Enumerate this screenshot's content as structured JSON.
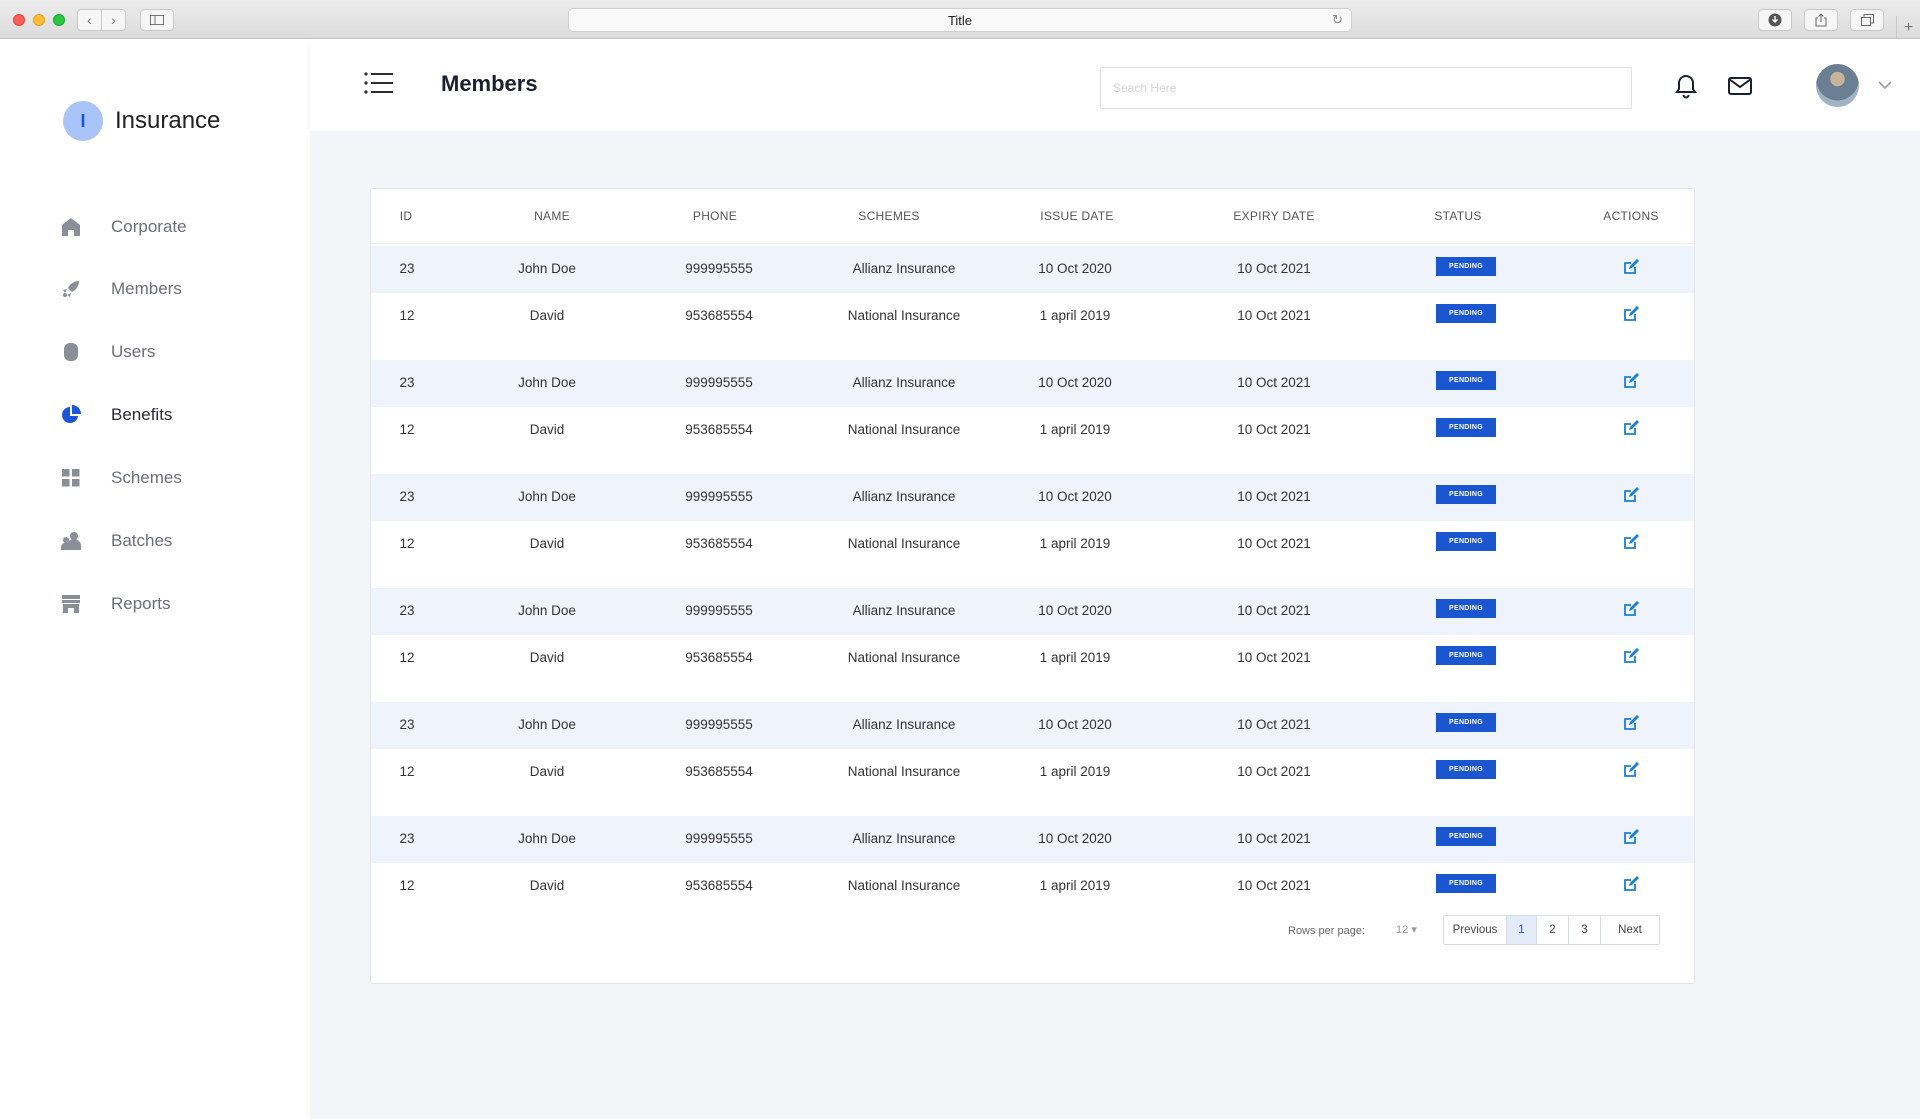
{
  "browser": {
    "title": "Title"
  },
  "sidebar": {
    "logo_letter": "I",
    "logo_text": "Insurance",
    "items": [
      {
        "label": "Corporate",
        "icon": "home-icon"
      },
      {
        "label": "Members",
        "icon": "rocket-icon"
      },
      {
        "label": "Users",
        "icon": "user-icon"
      },
      {
        "label": "Benefits",
        "icon": "pie-chart-icon",
        "active": true
      },
      {
        "label": "Schemes",
        "icon": "grid-icon"
      },
      {
        "label": "Batches",
        "icon": "users-icon"
      },
      {
        "label": "Reports",
        "icon": "store-icon"
      }
    ]
  },
  "header": {
    "title": "Members",
    "search_placeholder": "Seach Here"
  },
  "table": {
    "columns": [
      "ID",
      "NAME",
      "PHONE",
      "SCHEMES",
      "ISSUE DATE",
      "EXPIRY DATE",
      "STATUS",
      "ACTIONS"
    ],
    "rows": [
      {
        "id": "23",
        "name": "John Doe",
        "phone": "999995555",
        "scheme": "Allianz Insurance",
        "issue": "10 Oct 2020",
        "expiry": "10 Oct 2021",
        "status": "PENDING"
      },
      {
        "id": "12",
        "name": "David",
        "phone": "953685554",
        "scheme": "National Insurance",
        "issue": "1 april 2019",
        "expiry": "10 Oct 2021",
        "status": "PENDING"
      },
      {
        "id": "23",
        "name": "John Doe",
        "phone": "999995555",
        "scheme": "Allianz Insurance",
        "issue": "10 Oct 2020",
        "expiry": "10 Oct 2021",
        "status": "PENDING"
      },
      {
        "id": "12",
        "name": "David",
        "phone": "953685554",
        "scheme": "National Insurance",
        "issue": "1 april 2019",
        "expiry": "10 Oct 2021",
        "status": "PENDING"
      },
      {
        "id": "23",
        "name": "John Doe",
        "phone": "999995555",
        "scheme": "Allianz Insurance",
        "issue": "10 Oct 2020",
        "expiry": "10 Oct 2021",
        "status": "PENDING"
      },
      {
        "id": "12",
        "name": "David",
        "phone": "953685554",
        "scheme": "National Insurance",
        "issue": "1 april 2019",
        "expiry": "10 Oct 2021",
        "status": "PENDING"
      },
      {
        "id": "23",
        "name": "John Doe",
        "phone": "999995555",
        "scheme": "Allianz Insurance",
        "issue": "10 Oct 2020",
        "expiry": "10 Oct 2021",
        "status": "PENDING"
      },
      {
        "id": "12",
        "name": "David",
        "phone": "953685554",
        "scheme": "National Insurance",
        "issue": "1 april 2019",
        "expiry": "10 Oct 2021",
        "status": "PENDING"
      },
      {
        "id": "23",
        "name": "John Doe",
        "phone": "999995555",
        "scheme": "Allianz Insurance",
        "issue": "10 Oct 2020",
        "expiry": "10 Oct 2021",
        "status": "PENDING"
      },
      {
        "id": "12",
        "name": "David",
        "phone": "953685554",
        "scheme": "National Insurance",
        "issue": "1 april 2019",
        "expiry": "10 Oct 2021",
        "status": "PENDING"
      },
      {
        "id": "23",
        "name": "John Doe",
        "phone": "999995555",
        "scheme": "Allianz Insurance",
        "issue": "10 Oct 2020",
        "expiry": "10 Oct 2021",
        "status": "PENDING"
      },
      {
        "id": "12",
        "name": "David",
        "phone": "953685554",
        "scheme": "National Insurance",
        "issue": "1 april 2019",
        "expiry": "10 Oct 2021",
        "status": "PENDING"
      }
    ]
  },
  "pagination": {
    "rows_per_page_label": "Rows per page:",
    "rows_per_page_value": "12",
    "previous": "Previous",
    "pages": [
      "1",
      "2",
      "3"
    ],
    "current_page": "1",
    "next": "Next"
  },
  "colors": {
    "accent": "#1a56cf",
    "row_shade": "#eef3fc",
    "background": "#f4f5f9"
  }
}
